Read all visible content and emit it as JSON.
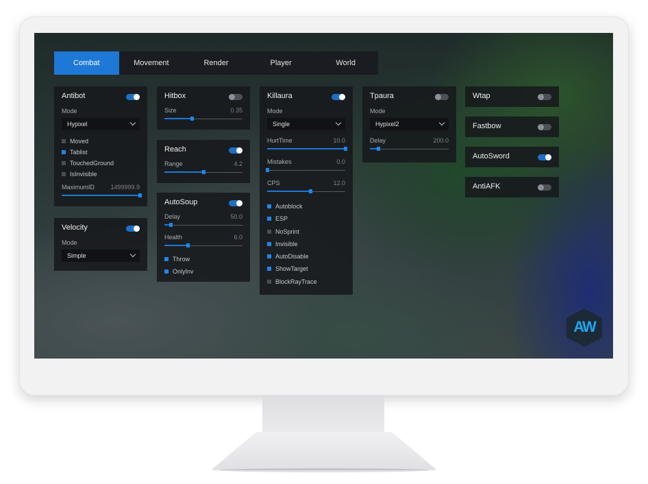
{
  "tabs": [
    {
      "label": "Combat",
      "active": true
    },
    {
      "label": "Movement",
      "active": false
    },
    {
      "label": "Render",
      "active": false
    },
    {
      "label": "Player",
      "active": false
    },
    {
      "label": "World",
      "active": false
    }
  ],
  "antibot": {
    "title": "Antibot",
    "enabled": true,
    "mode_label": "Mode",
    "mode_value": "Hypixel",
    "options": [
      {
        "label": "Moved",
        "checked": false
      },
      {
        "label": "Tablist",
        "checked": true
      },
      {
        "label": "TouchedGround",
        "checked": false
      },
      {
        "label": "IsInvisible",
        "checked": false
      }
    ],
    "maxid": {
      "label": "MaximumID",
      "value": "1499999.9",
      "fraction": 1.0
    }
  },
  "velocity": {
    "title": "Velocity",
    "enabled": true,
    "mode_label": "Mode",
    "mode_value": "Simple"
  },
  "hitbox": {
    "title": "Hitbox",
    "enabled": false,
    "size": {
      "label": "Size",
      "value": "0.35",
      "fraction": 0.35
    }
  },
  "reach": {
    "title": "Reach",
    "enabled": true,
    "range": {
      "label": "Range",
      "value": "4.2",
      "fraction": 0.5
    }
  },
  "autosoup": {
    "title": "AutoSoup",
    "enabled": true,
    "delay": {
      "label": "Delay",
      "value": "50.0",
      "fraction": 0.08
    },
    "health": {
      "label": "Health",
      "value": "6.0",
      "fraction": 0.3
    },
    "options": [
      {
        "label": "Throw",
        "checked": true
      },
      {
        "label": "OnlyInv",
        "checked": true
      }
    ]
  },
  "killaura": {
    "title": "Killaura",
    "enabled": true,
    "mode_label": "Mode",
    "mode_value": "Single",
    "hurttime": {
      "label": "HurtTime",
      "value": "10.0",
      "fraction": 1.0
    },
    "mistakes": {
      "label": "Mistakes",
      "value": "0.0",
      "fraction": 0.0
    },
    "cps": {
      "label": "CPS",
      "value": "12.0",
      "fraction": 0.55
    },
    "options": [
      {
        "label": "Autoblock",
        "checked": true
      },
      {
        "label": "ESP",
        "checked": true
      },
      {
        "label": "NoSprint",
        "checked": false
      },
      {
        "label": "Invisible",
        "checked": true
      },
      {
        "label": "AutoDisable",
        "checked": true
      },
      {
        "label": "ShowTarget",
        "checked": true
      },
      {
        "label": "BlockRayTrace",
        "checked": false
      }
    ]
  },
  "tpaura": {
    "title": "Tpaura",
    "enabled": false,
    "mode_label": "Mode",
    "mode_value": "Hypixel2",
    "delay": {
      "label": "Delay",
      "value": "200.0",
      "fraction": 0.1
    }
  },
  "wtap": {
    "title": "Wtap",
    "enabled": false
  },
  "fastbow": {
    "title": "Fastbow",
    "enabled": false
  },
  "autosword": {
    "title": "AutoSword",
    "enabled": true
  },
  "antiafk": {
    "title": "AntiAFK",
    "enabled": false
  },
  "logo": {
    "text": "AW"
  },
  "colors": {
    "accent": "#1e78d6",
    "panel": "#16181c"
  }
}
